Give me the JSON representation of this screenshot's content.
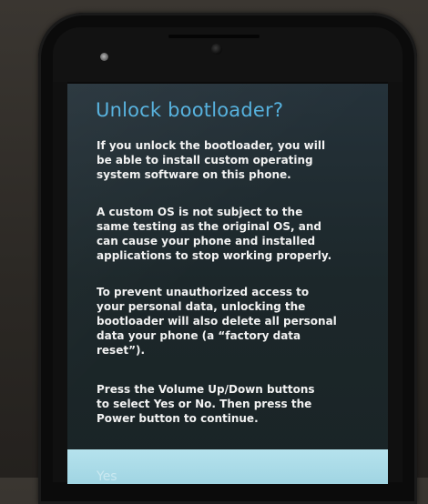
{
  "dialog": {
    "title": "Unlock bootloader?",
    "paragraphs": [
      {
        "lines": [
          "If you unlock the bootloader, you will",
          "be able to install custom operating",
          "system software on this phone."
        ]
      },
      {
        "lines": [
          "A custom OS is not subject to the",
          "same testing as the original OS, and",
          "can cause your phone and installed",
          "applications to stop working properly."
        ]
      },
      {
        "lines": [
          "To prevent unauthorized access to",
          "your personal data, unlocking the",
          "bootloader will also delete all personal",
          "data your phone (a “factory data",
          "reset”)."
        ]
      },
      {
        "lines": [
          "Press the Volume Up/Down buttons",
          "to select Yes or No. Then press the",
          "Power button to continue."
        ]
      }
    ],
    "selected_option": "Yes"
  },
  "colors": {
    "title": "#54b1de",
    "screen_background": "#1f2c2f",
    "body_text": "#f2f2f2",
    "selection_bar": "#a8dbe8"
  }
}
